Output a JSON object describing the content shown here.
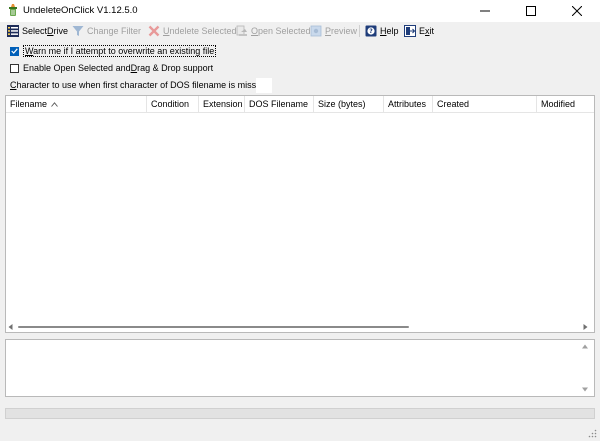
{
  "window": {
    "title": "UndeleteOnClick V1.12.5.0",
    "icon": "recycle-app-icon"
  },
  "toolbar": {
    "select_drive": {
      "prefix": "Select ",
      "accel": "D",
      "suffix": "rive",
      "icon": "drive-list-icon",
      "enabled": true
    },
    "change_filter": {
      "label": "Change Filter",
      "icon": "funnel-icon",
      "enabled": false
    },
    "undelete_selected": {
      "accel": "U",
      "suffix": "ndelete Selected",
      "icon": "red-x-icon",
      "enabled": false
    },
    "open_selected": {
      "accel": "O",
      "suffix": "pen Selected",
      "icon": "open-file-icon",
      "enabled": false
    },
    "preview": {
      "accel": "P",
      "suffix": "review",
      "icon": "preview-icon",
      "enabled": false
    },
    "help": {
      "accel": "H",
      "suffix": "elp",
      "icon": "help-book-icon",
      "enabled": true
    },
    "exit": {
      "prefix": "E",
      "accel": "x",
      "suffix": "it",
      "icon": "exit-door-icon",
      "enabled": true
    }
  },
  "options": {
    "warn_overwrite": {
      "accel": "W",
      "suffix": "arn me if I attempt to overwrite an existing file",
      "checked": true
    },
    "enable_open": {
      "before": "Enable Open Selected and ",
      "accel": "D",
      "after": "rag & Drop support",
      "checked": false
    },
    "char_label": {
      "accel": "C",
      "suffix": "haracter to use when first character of DOS filename is missing:"
    },
    "char_value": ""
  },
  "file_list": {
    "columns": [
      "Filename",
      "Condition",
      "Extension",
      "DOS Filename",
      "Size (bytes)",
      "Attributes",
      "Created",
      "Modified"
    ],
    "sorted_column": "Filename",
    "sort_direction": "ascending",
    "rows": []
  },
  "detail_text": "",
  "colors": {
    "accent": "#005fb8",
    "disabled_text": "#a0a0a0",
    "window_bg": "#f0f0f0"
  }
}
